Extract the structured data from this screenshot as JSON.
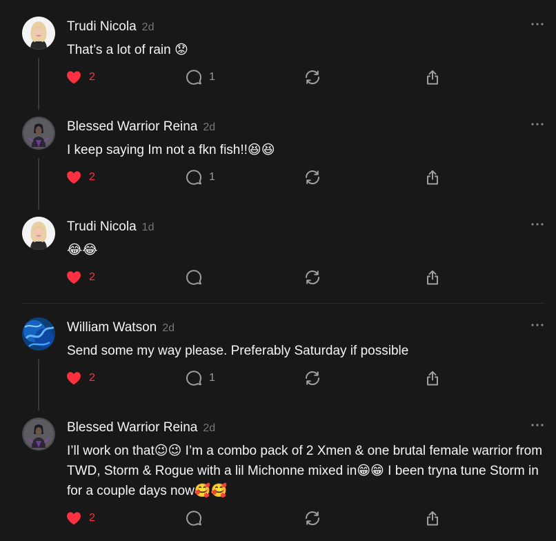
{
  "colors": {
    "background": "#181818",
    "text": "#f3f5f7",
    "muted": "#777777",
    "like": "#ff3040",
    "thread_line": "#3a3a3a"
  },
  "posts": [
    {
      "username": "Trudi Nicola",
      "time": "2d",
      "text": "That’s a lot of rain 😟",
      "likes": "2",
      "replies": "1",
      "avatar": "blonde-woman-avatar"
    },
    {
      "username": "Blessed Warrior Reina",
      "time": "2d",
      "text": "I keep saying Im not a fkn fish!!😆😆",
      "likes": "2",
      "replies": "1",
      "avatar": "warrior-avatar"
    },
    {
      "username": "Trudi Nicola",
      "time": "1d",
      "text": "😂😂",
      "likes": "2",
      "replies": "",
      "avatar": "blonde-woman-avatar"
    },
    {
      "username": "William Watson",
      "time": "2d",
      "text": "Send some my way please. Preferably Saturday if possible",
      "likes": "2",
      "replies": "1",
      "avatar": "blue-abstract-avatar"
    },
    {
      "username": "Blessed Warrior Reina",
      "time": "2d",
      "text": "I’ll work on that😉😉 I’m a combo pack of 2 Xmen & one brutal female warrior from TWD, Storm & Rogue with a lil Michonne mixed in😁😁 I been tryna tune Storm in for a couple days now🥰🥰",
      "likes": "2",
      "replies": "",
      "avatar": "warrior-avatar"
    }
  ],
  "icons": {
    "like": "heart-icon",
    "reply": "comment-icon",
    "repost": "repost-icon",
    "share": "share-icon",
    "more": "more-icon"
  }
}
